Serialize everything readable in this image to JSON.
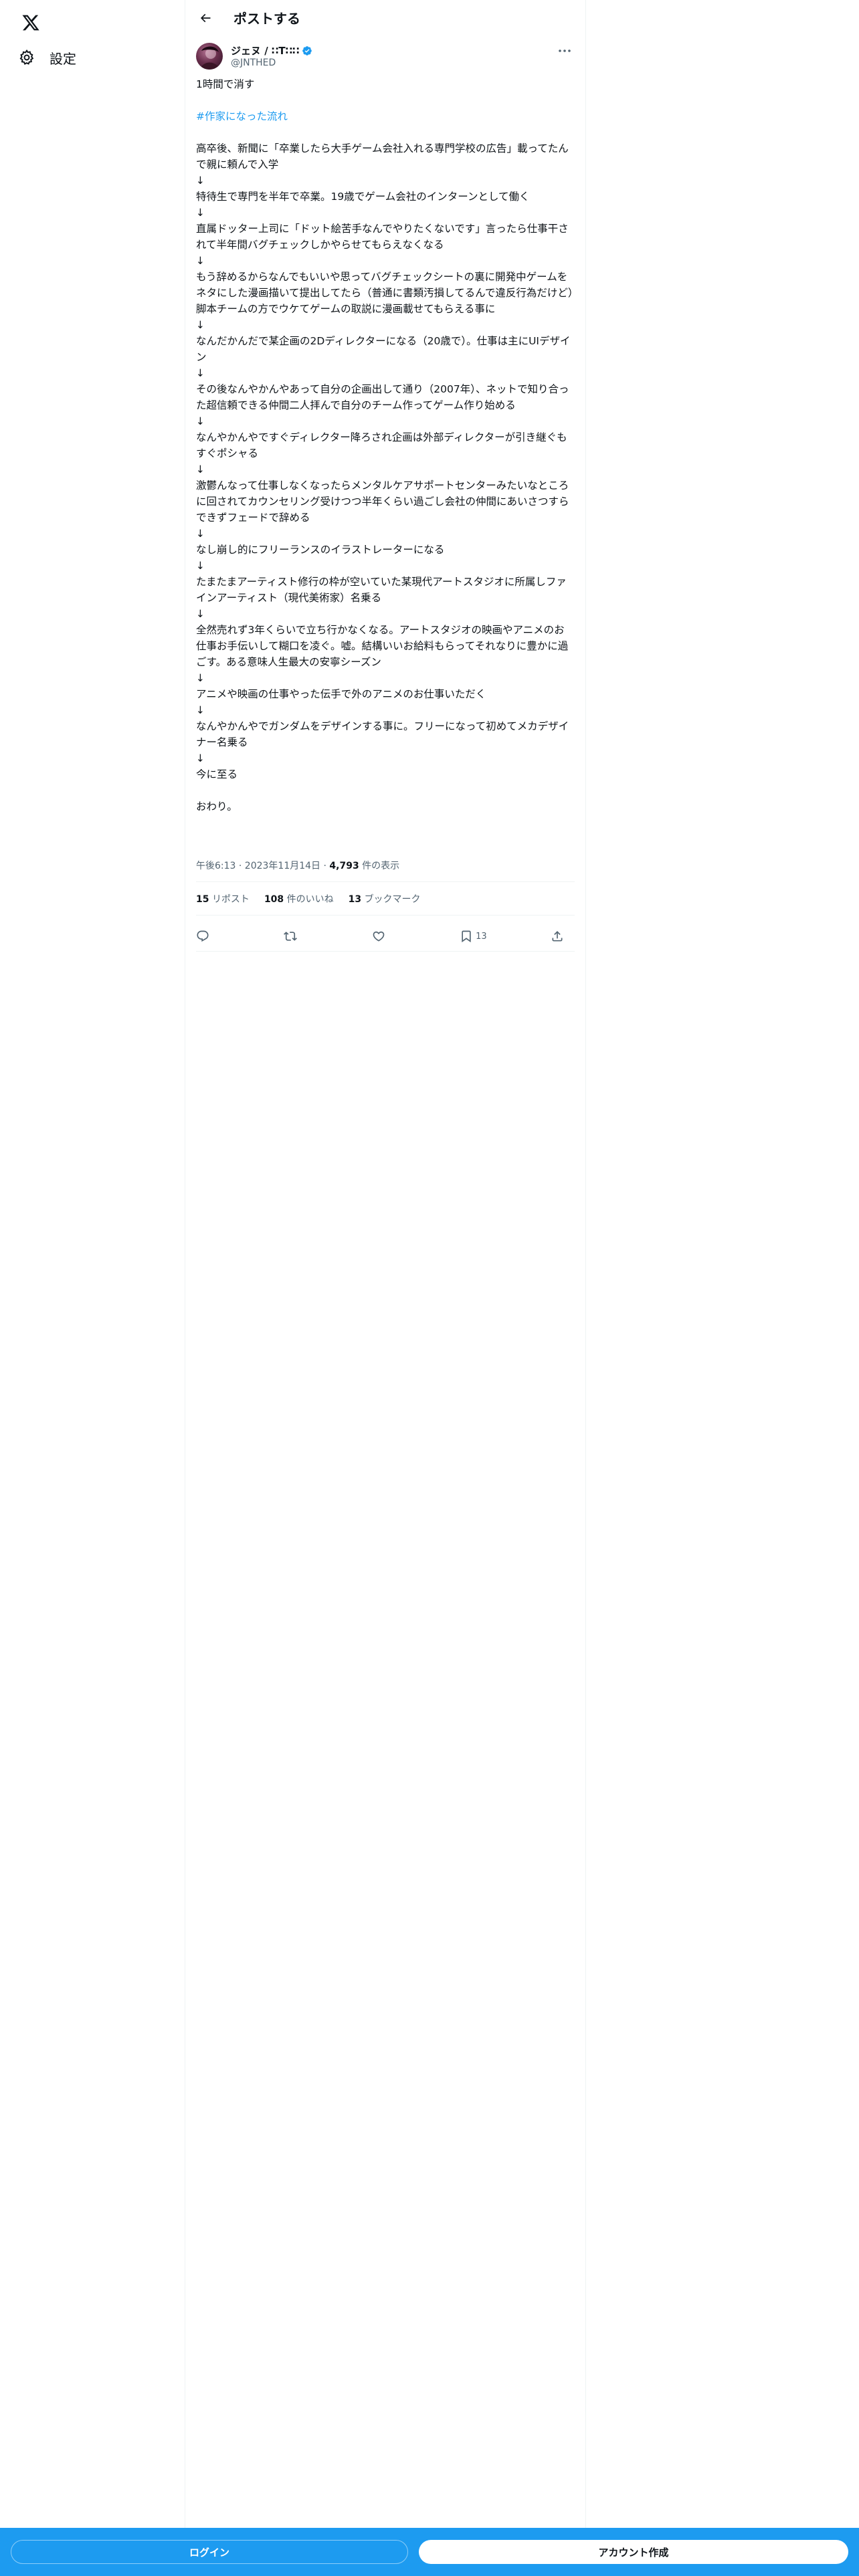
{
  "nav": {
    "logo_icon": "x-logo-icon",
    "settings_label": "設定",
    "settings_icon": "gear-icon"
  },
  "header": {
    "title": "ポストする",
    "back_icon": "arrow-left-icon"
  },
  "post": {
    "author": {
      "display_name": "ジェヌ / ∷T∷∷",
      "handle": "@JNTHED",
      "verified": true
    },
    "lines": [
      "1時間で消す",
      "",
      "#作家になった流れ",
      "",
      "高卒後、新聞に「卒業したら大手ゲーム会社入れる専門学校の広告」載ってたんで親に頼んで入学",
      "↓",
      "特待生で専門を半年で卒業。19歳でゲーム会社のインターンとして働く",
      "↓",
      "直属ドッター上司に「ドット絵苦手なんでやりたくないです」言ったら仕事干されて半年間バグチェックしかやらせてもらえなくなる",
      "↓",
      "もう辞めるからなんでもいいや思ってバグチェックシートの裏に開発中ゲームをネタにした漫画描いて提出してたら（普通に書類汚損してるんで違反行為だけど）脚本チームの方でウケてゲームの取説に漫画載せてもらえる事に",
      "↓",
      "なんだかんだで某企画の2Dディレクターになる（20歳で）。仕事は主にUIデザイン",
      "↓",
      "その後なんやかんやあって自分の企画出して通り（2007年）、ネットで知り合った超信頼できる仲間二人拝んで自分のチーム作ってゲーム作り始める",
      "↓",
      "なんやかんやですぐディレクター降ろされ企画は外部ディレクターが引き継ぐもすぐポシャる",
      "↓",
      "激鬱んなって仕事しなくなったらメンタルケアサポートセンターみたいなところに回されてカウンセリング受けつつ半年くらい過ごし会社の仲間にあいさつすらできずフェードで辞める",
      "↓",
      "なし崩し的にフリーランスのイラストレーターになる",
      "↓",
      "たまたまアーティスト修行の枠が空いていた某現代アートスタジオに所属しファインアーティスト（現代美術家）名乗る",
      "↓",
      "全然売れず3年くらいで立ち行かなくなる。アートスタジオの映画やアニメのお仕事お手伝いして糊口を凌ぐ。嘘。結構いいお給料もらってそれなりに豊かに過ごす。ある意味人生最大の安寧シーズン",
      "↓",
      "アニメや映画の仕事やった伝手で外のアニメのお仕事いただく",
      "↓",
      "なんやかんやでガンダムをデザインする事に。フリーになって初めてメカデザイナー名乗る",
      "↓",
      "今に至る",
      "",
      "おわり。"
    ],
    "timestamp": "午後6:13 · 2023年11月14日",
    "views_count": "4,793",
    "views_label": "件の表示",
    "stats": {
      "reposts_count": "15",
      "reposts_label": "リポスト",
      "likes_count": "108",
      "likes_label": "件のいいね",
      "bookmarks_count": "13",
      "bookmarks_label": "ブックマーク"
    },
    "actions": {
      "bookmark_count": "13"
    }
  },
  "bottom": {
    "login_label": "ログイン",
    "signup_label": "アカウント作成"
  },
  "colors": {
    "accent": "#1d9bf0",
    "text": "#0f1419",
    "muted": "#536471"
  }
}
